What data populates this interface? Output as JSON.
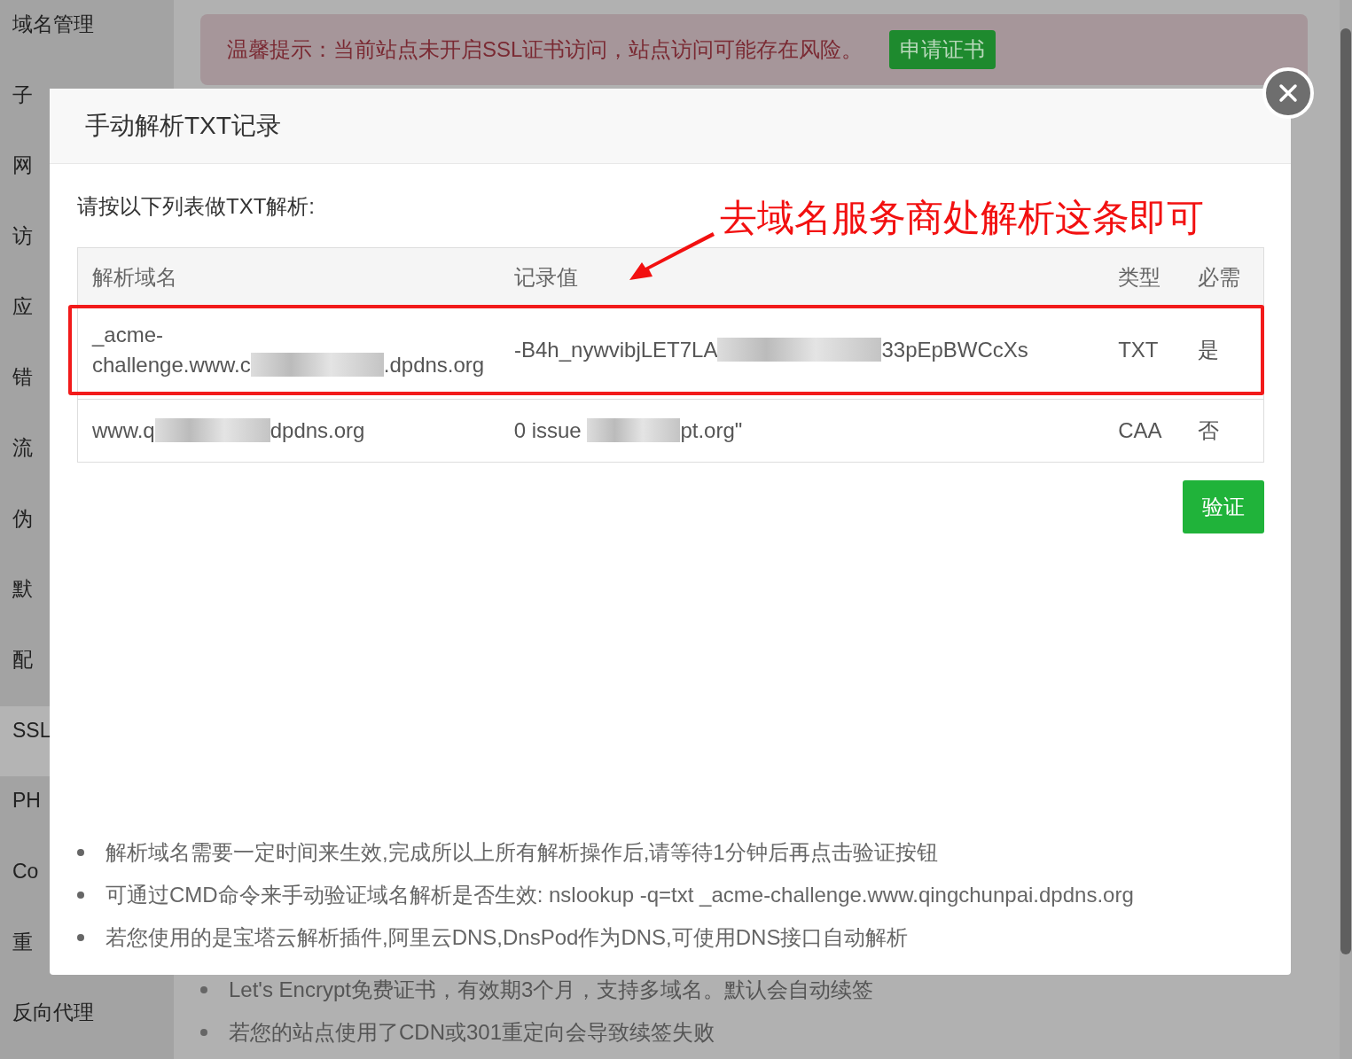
{
  "sidebar": {
    "items": [
      {
        "label": "域名管理",
        "selected": false
      },
      {
        "label": "子",
        "selected": false
      },
      {
        "label": "网",
        "selected": false
      },
      {
        "label": "访",
        "selected": false
      },
      {
        "label": "应",
        "selected": false
      },
      {
        "label": "错",
        "selected": false
      },
      {
        "label": "流",
        "selected": false
      },
      {
        "label": "伪",
        "selected": false
      },
      {
        "label": "默",
        "selected": false
      },
      {
        "label": "配",
        "selected": false
      },
      {
        "label": "SSL",
        "selected": true
      },
      {
        "label": "PH",
        "selected": false
      },
      {
        "label": "Co",
        "selected": false
      },
      {
        "label": "重",
        "selected": false
      },
      {
        "label": "反向代理",
        "selected": false
      }
    ]
  },
  "alert": {
    "text": "温馨提示：当前站点未开启SSL证书访问，站点访问可能存在风险。",
    "button": "申请证书"
  },
  "dialog": {
    "title": "手动解析TXT记录",
    "instruction": "请按以下列表做TXT解析:",
    "annotation": "去域名服务商处解析这条即可",
    "table": {
      "columns": [
        "解析域名",
        "记录值",
        "类型",
        "必需"
      ],
      "rows": [
        {
          "highlighted": true,
          "cells": [
            [
              "_acme-challenge.www.c",
              ".dpdns.org"
            ],
            [
              "-B4h_nywvibjLET7LA",
              "33pEpBWCcXs"
            ],
            [
              "TXT"
            ],
            [
              "是"
            ]
          ]
        },
        {
          "highlighted": false,
          "cells": [
            [
              "www.q",
              "dpdns.org"
            ],
            [
              "0 issue ",
              "pt.org\""
            ],
            [
              "CAA"
            ],
            [
              "否"
            ]
          ]
        }
      ]
    },
    "verify_button": "验证",
    "notes": [
      "解析域名需要一定时间来生效,完成所以上所有解析操作后,请等待1分钟后再点击验证按钮",
      "可通过CMD命令来手动验证域名解析是否生效: nslookup -q=txt _acme-challenge.www.qingchunpai.dpdns.org",
      "若您使用的是宝塔云解析插件,阿里云DNS,DnsPod作为DNS,可使用DNS接口自动解析"
    ]
  },
  "page_notes": [
    "Let's Encrypt免费证书，有效期3个月，支持多域名。默认会自动续签",
    "若您的站点使用了CDN或301重定向会导致续签失败"
  ]
}
